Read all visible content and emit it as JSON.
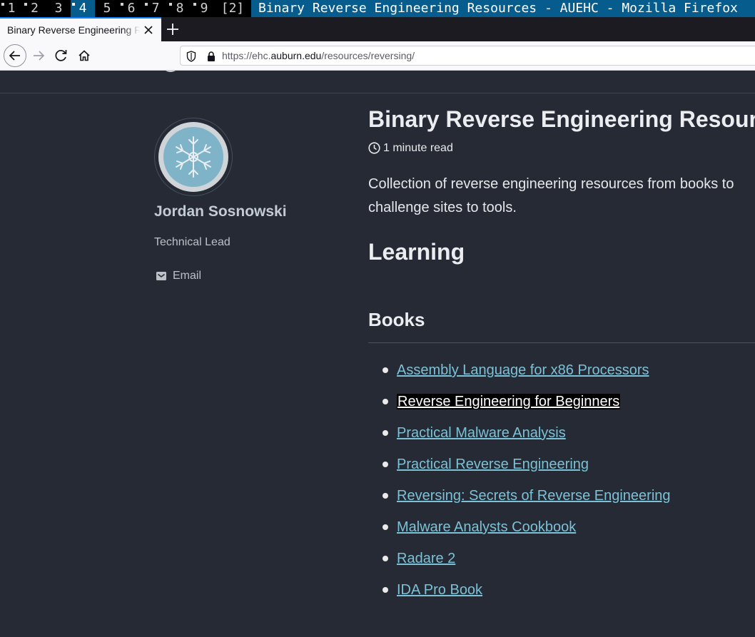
{
  "window_manager": {
    "workspaces": [
      {
        "label": "1",
        "marked": true,
        "active": false
      },
      {
        "label": "2",
        "marked": true,
        "active": false
      },
      {
        "label": "3",
        "marked": false,
        "active": false
      },
      {
        "label": "4",
        "marked": true,
        "active": true
      },
      {
        "label": "5",
        "marked": false,
        "active": false
      },
      {
        "label": "6",
        "marked": true,
        "active": false
      },
      {
        "label": "7",
        "marked": true,
        "active": false
      },
      {
        "label": "8",
        "marked": true,
        "active": false
      },
      {
        "label": "9",
        "marked": true,
        "active": false
      }
    ],
    "layout_indicator": "[2]",
    "window_title": "Binary Reverse Engineering Resources - AUEHC - Mozilla Firefox",
    "active_color": "#075c8e"
  },
  "browser": {
    "tab": {
      "title": "Binary Reverse Engineering Resources - AUEHC"
    },
    "url": {
      "prefix": "https://ehc.",
      "domain": "auburn.edu",
      "path": "/resources/reversing/"
    }
  },
  "author": {
    "name": "Jordan Sosnowski",
    "bio": "Technical Lead",
    "email_label": "Email",
    "avatar_icon": "snowflake-icon"
  },
  "article": {
    "title": "Binary Reverse Engineering Resources",
    "read_time": "1 minute read",
    "excerpt": "Collection of reverse engineering resources from books to challenge sites to tools.",
    "section_heading": "Learning",
    "subsection_heading": "Books",
    "books": [
      {
        "title": "Assembly Language for x86 Processors"
      },
      {
        "title": "Reverse Engineering for Beginners",
        "selected": true
      },
      {
        "title": "Practical Malware Analysis"
      },
      {
        "title": "Practical Reverse Engineering"
      },
      {
        "title": "Reversing: Secrets of Reverse Engineering"
      },
      {
        "title": "Malware Analysts Cookbook"
      },
      {
        "title": "Radare 2"
      },
      {
        "title": "IDA Pro Book"
      }
    ],
    "link_color": "#7cc1d6"
  }
}
